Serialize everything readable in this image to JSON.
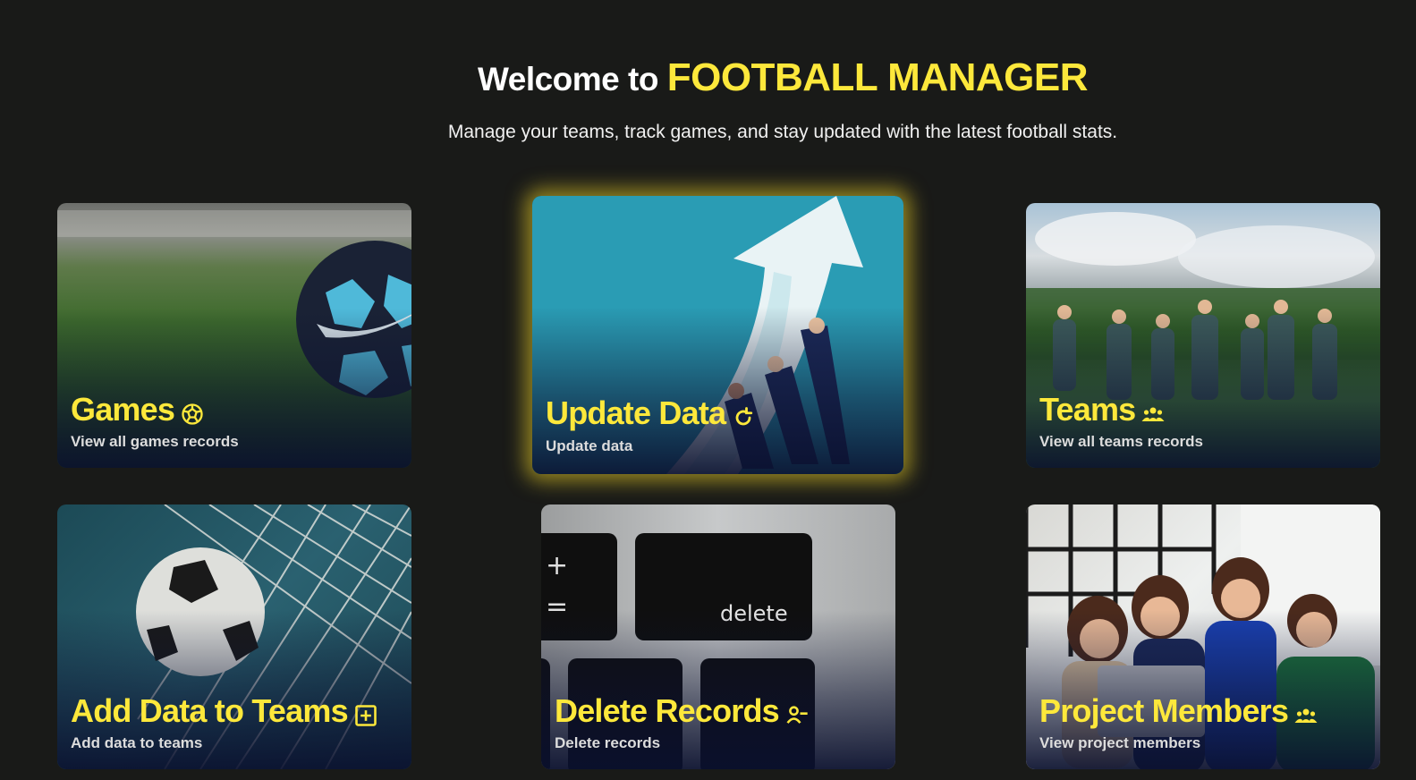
{
  "header": {
    "title_prefix": "Welcome to ",
    "title_brand": "FOOTBALL MANAGER",
    "subtitle": "Manage your teams, track games, and stay updated with the latest football stats."
  },
  "cards": [
    {
      "title": "Games",
      "description": "View all games records",
      "icon": "soccer-ball-icon"
    },
    {
      "title": "Update Data",
      "description": "Update data",
      "icon": "refresh-icon"
    },
    {
      "title": "Teams",
      "description": "View all teams records",
      "icon": "users-icon"
    },
    {
      "title": "Add Data to Teams",
      "description": "Add data to teams",
      "icon": "plus-square-icon"
    },
    {
      "title": "Delete Records",
      "description": "Delete records",
      "icon": "user-minus-icon"
    },
    {
      "title": "Project Members",
      "description": "View project members",
      "icon": "users-icon"
    }
  ],
  "colors": {
    "accent": "#fde83b",
    "background": "#191a18"
  }
}
